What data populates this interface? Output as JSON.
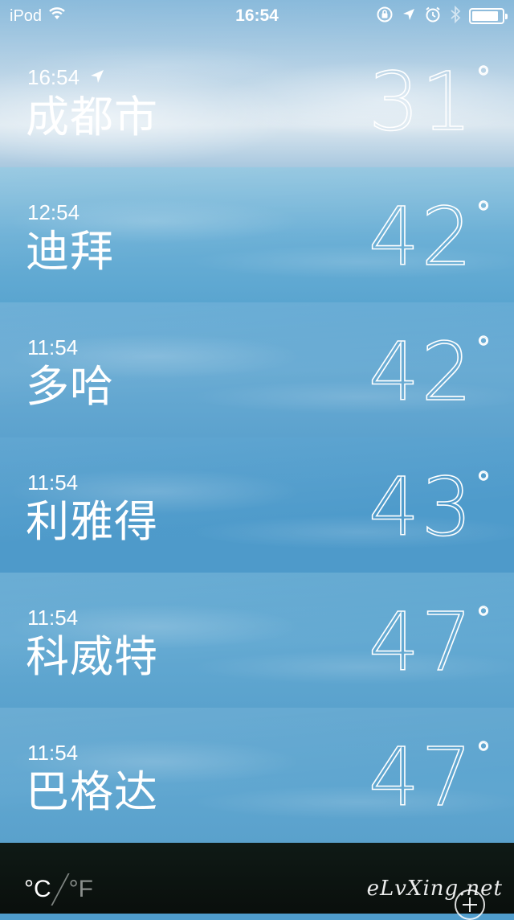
{
  "status_bar": {
    "carrier": "iPod",
    "time": "16:54",
    "icons": [
      "wifi-icon",
      "orientation-lock-icon",
      "location-icon",
      "alarm-icon",
      "bluetooth-icon",
      "battery-icon"
    ],
    "battery_level": 0.9
  },
  "cities": [
    {
      "time": "16:54",
      "name": "成都市",
      "temp": "31",
      "degree": "°",
      "current_location": true
    },
    {
      "time": "12:54",
      "name": "迪拜",
      "temp": "42",
      "degree": "°"
    },
    {
      "time": "11:54",
      "name": "多哈",
      "temp": "42",
      "degree": "°"
    },
    {
      "time": "11:54",
      "name": "利雅得",
      "temp": "43",
      "degree": "°"
    },
    {
      "time": "11:54",
      "name": "科威特",
      "temp": "47",
      "degree": "°"
    },
    {
      "time": "11:54",
      "name": "巴格达",
      "temp": "47",
      "degree": "°"
    }
  ],
  "footer": {
    "unit_celsius": "°C",
    "unit_fahrenheit": "°F",
    "watermark": "eLvXing.net"
  }
}
